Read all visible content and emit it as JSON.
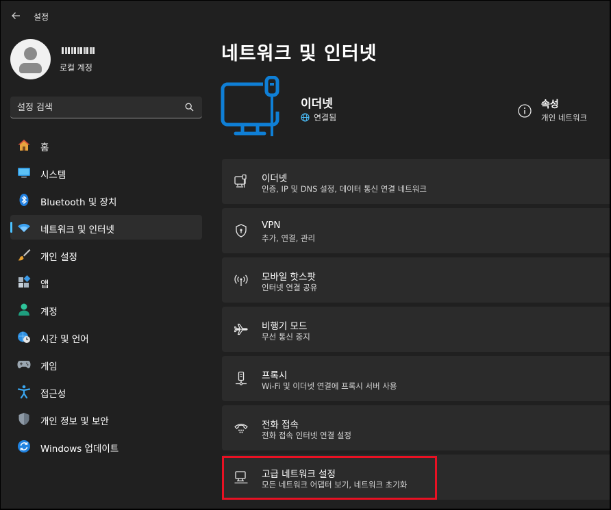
{
  "window": {
    "title": "설정"
  },
  "profile": {
    "account_type": "로컬 계정"
  },
  "search": {
    "placeholder": "설정 검색"
  },
  "sidebar": {
    "items": [
      {
        "label": "홈",
        "icon": "home-icon",
        "active": false
      },
      {
        "label": "시스템",
        "icon": "system-icon",
        "active": false
      },
      {
        "label": "Bluetooth 및 장치",
        "icon": "bluetooth-icon",
        "active": false
      },
      {
        "label": "네트워크 및 인터넷",
        "icon": "wifi-icon",
        "active": true
      },
      {
        "label": "개인 설정",
        "icon": "brush-icon",
        "active": false
      },
      {
        "label": "앱",
        "icon": "apps-icon",
        "active": false
      },
      {
        "label": "계정",
        "icon": "account-icon",
        "active": false
      },
      {
        "label": "시간 및 언어",
        "icon": "time-language-icon",
        "active": false
      },
      {
        "label": "게임",
        "icon": "gamepad-icon",
        "active": false
      },
      {
        "label": "접근성",
        "icon": "accessibility-icon",
        "active": false
      },
      {
        "label": "개인 정보 및 보안",
        "icon": "shield-icon",
        "active": false
      },
      {
        "label": "Windows 업데이트",
        "icon": "update-icon",
        "active": false
      }
    ]
  },
  "main": {
    "title": "네트워크 및 인터넷",
    "hero": {
      "name": "이더넷",
      "status": "연결됨",
      "properties_title": "속성",
      "properties_sub": "개인 네트워크"
    },
    "cards": [
      {
        "title": "이더넷",
        "subtitle": "인증, IP 및 DNS 설정, 데이터 통신 연결 네트워크",
        "icon": "ethernet-icon"
      },
      {
        "title": "VPN",
        "subtitle": "추가, 연결, 관리",
        "icon": "vpn-shield-icon"
      },
      {
        "title": "모바일 핫스팟",
        "subtitle": "인터넷 연결 공유",
        "icon": "hotspot-icon"
      },
      {
        "title": "비행기 모드",
        "subtitle": "무선 통신 중지",
        "icon": "airplane-icon"
      },
      {
        "title": "프록시",
        "subtitle": "Wi-Fi 및 이더넷 연결에 프록시 서버 사용",
        "icon": "proxy-icon"
      },
      {
        "title": "전화 접속",
        "subtitle": "전화 접속 인터넷 연결 설정",
        "icon": "dialup-icon"
      },
      {
        "title": "고급 네트워크 설정",
        "subtitle": "모든 네트워크 어댑터 보기, 네트워크 초기화",
        "icon": "advanced-network-icon"
      }
    ]
  },
  "colors": {
    "accent": "#4cc2ff",
    "highlight": "#e81123",
    "hero_icon": "#0f7fd6"
  }
}
